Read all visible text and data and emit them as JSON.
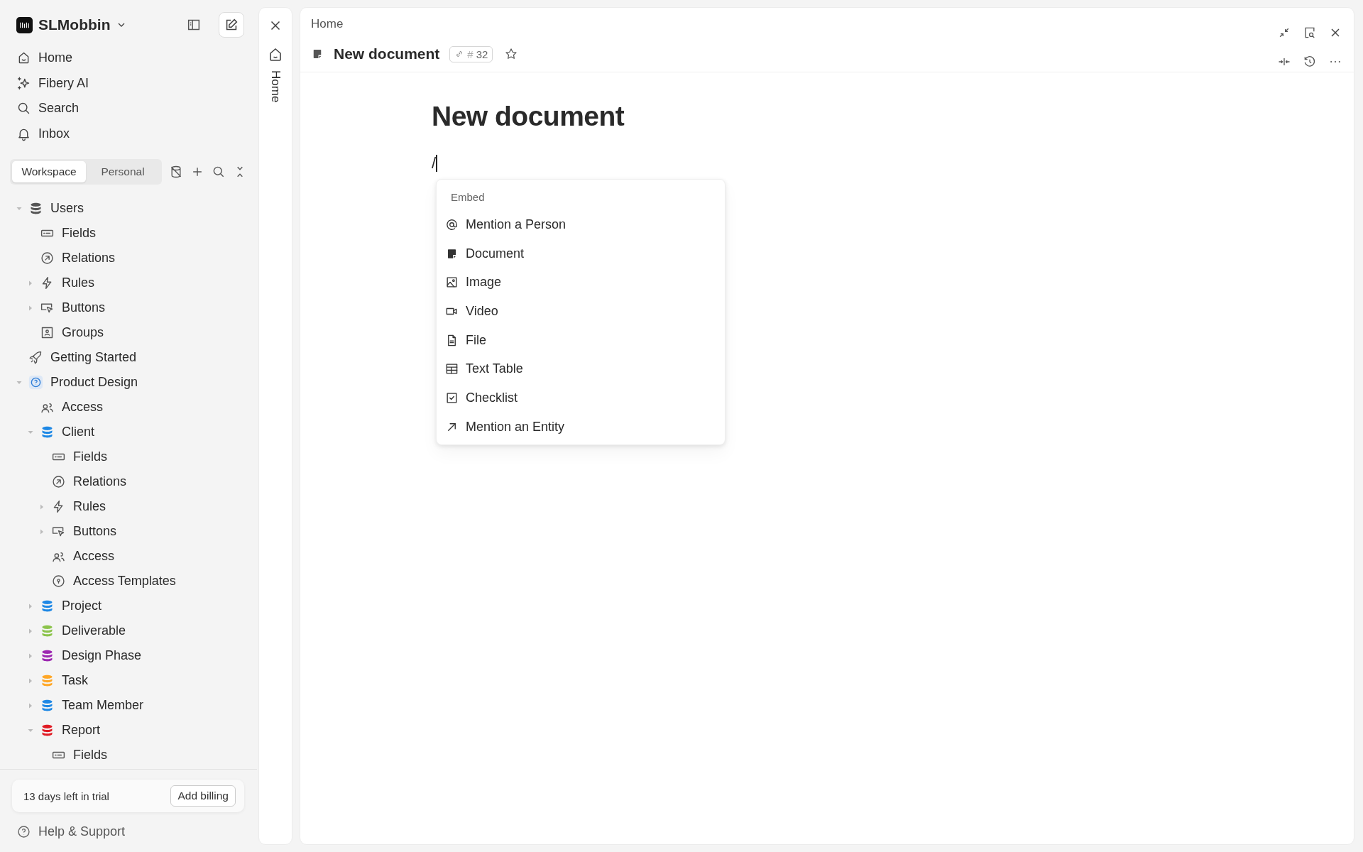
{
  "workspace": {
    "name": "SLMobbin"
  },
  "nav": [
    {
      "kind": "home",
      "label": "Home"
    },
    {
      "kind": "sparkle",
      "label": "Fibery AI"
    },
    {
      "kind": "search",
      "label": "Search"
    },
    {
      "kind": "bell",
      "label": "Inbox"
    }
  ],
  "scope_tabs": [
    {
      "label": "Workspace",
      "selected": true
    },
    {
      "label": "Personal",
      "selected": false
    }
  ],
  "tree": [
    {
      "kind": "database",
      "color": "#555555",
      "label": "Users",
      "expanded": true,
      "children": [
        {
          "kind": "fields",
          "label": "Fields"
        },
        {
          "kind": "relations",
          "label": "Relations"
        },
        {
          "kind": "rules",
          "label": "Rules",
          "expanded": false
        },
        {
          "kind": "buttons",
          "label": "Buttons",
          "expanded": false
        },
        {
          "kind": "groups",
          "label": "Groups"
        }
      ]
    },
    {
      "kind": "rocket",
      "label": "Getting Started"
    },
    {
      "kind": "space",
      "label": "Product Design",
      "expanded": true,
      "children": [
        {
          "kind": "access",
          "label": "Access"
        },
        {
          "kind": "database",
          "color": "#1e88e5",
          "label": "Client",
          "expanded": true,
          "children": [
            {
              "kind": "fields",
              "label": "Fields"
            },
            {
              "kind": "relations",
              "label": "Relations"
            },
            {
              "kind": "rules",
              "label": "Rules",
              "expanded": false
            },
            {
              "kind": "buttons",
              "label": "Buttons",
              "expanded": false
            },
            {
              "kind": "access",
              "label": "Access"
            },
            {
              "kind": "templates",
              "label": "Access Templates"
            }
          ]
        },
        {
          "kind": "database",
          "color": "#1e88e5",
          "label": "Project",
          "expanded": false
        },
        {
          "kind": "database",
          "color": "#8bc34a",
          "label": "Deliverable",
          "expanded": false
        },
        {
          "kind": "database",
          "color": "#9c27b0",
          "label": "Design Phase",
          "expanded": false
        },
        {
          "kind": "database",
          "color": "#ffa726",
          "label": "Task",
          "expanded": false
        },
        {
          "kind": "database",
          "color": "#1e88e5",
          "label": "Team Member",
          "expanded": false
        },
        {
          "kind": "database",
          "color": "#e01b24",
          "label": "Report",
          "expanded": true,
          "children": [
            {
              "kind": "fields",
              "label": "Fields"
            }
          ]
        }
      ]
    }
  ],
  "trial": {
    "text": "13 days left in trial",
    "button": "Add billing"
  },
  "help": {
    "label": "Help & Support"
  },
  "side_panel": {
    "label": "Home"
  },
  "document": {
    "breadcrumb": "Home",
    "title": "New document",
    "id_prefix": "#",
    "id": "32",
    "starred": false,
    "heading": "New document",
    "typed": "/"
  },
  "menu": {
    "section": "Embed",
    "items": [
      {
        "kind": "at",
        "label": "Mention a Person"
      },
      {
        "kind": "document",
        "label": "Document"
      },
      {
        "kind": "image",
        "label": "Image"
      },
      {
        "kind": "video",
        "label": "Video"
      },
      {
        "kind": "file",
        "label": "File"
      },
      {
        "kind": "table",
        "label": "Text Table"
      },
      {
        "kind": "checklist",
        "label": "Checklist"
      },
      {
        "kind": "arrow",
        "label": "Mention an Entity"
      }
    ]
  }
}
